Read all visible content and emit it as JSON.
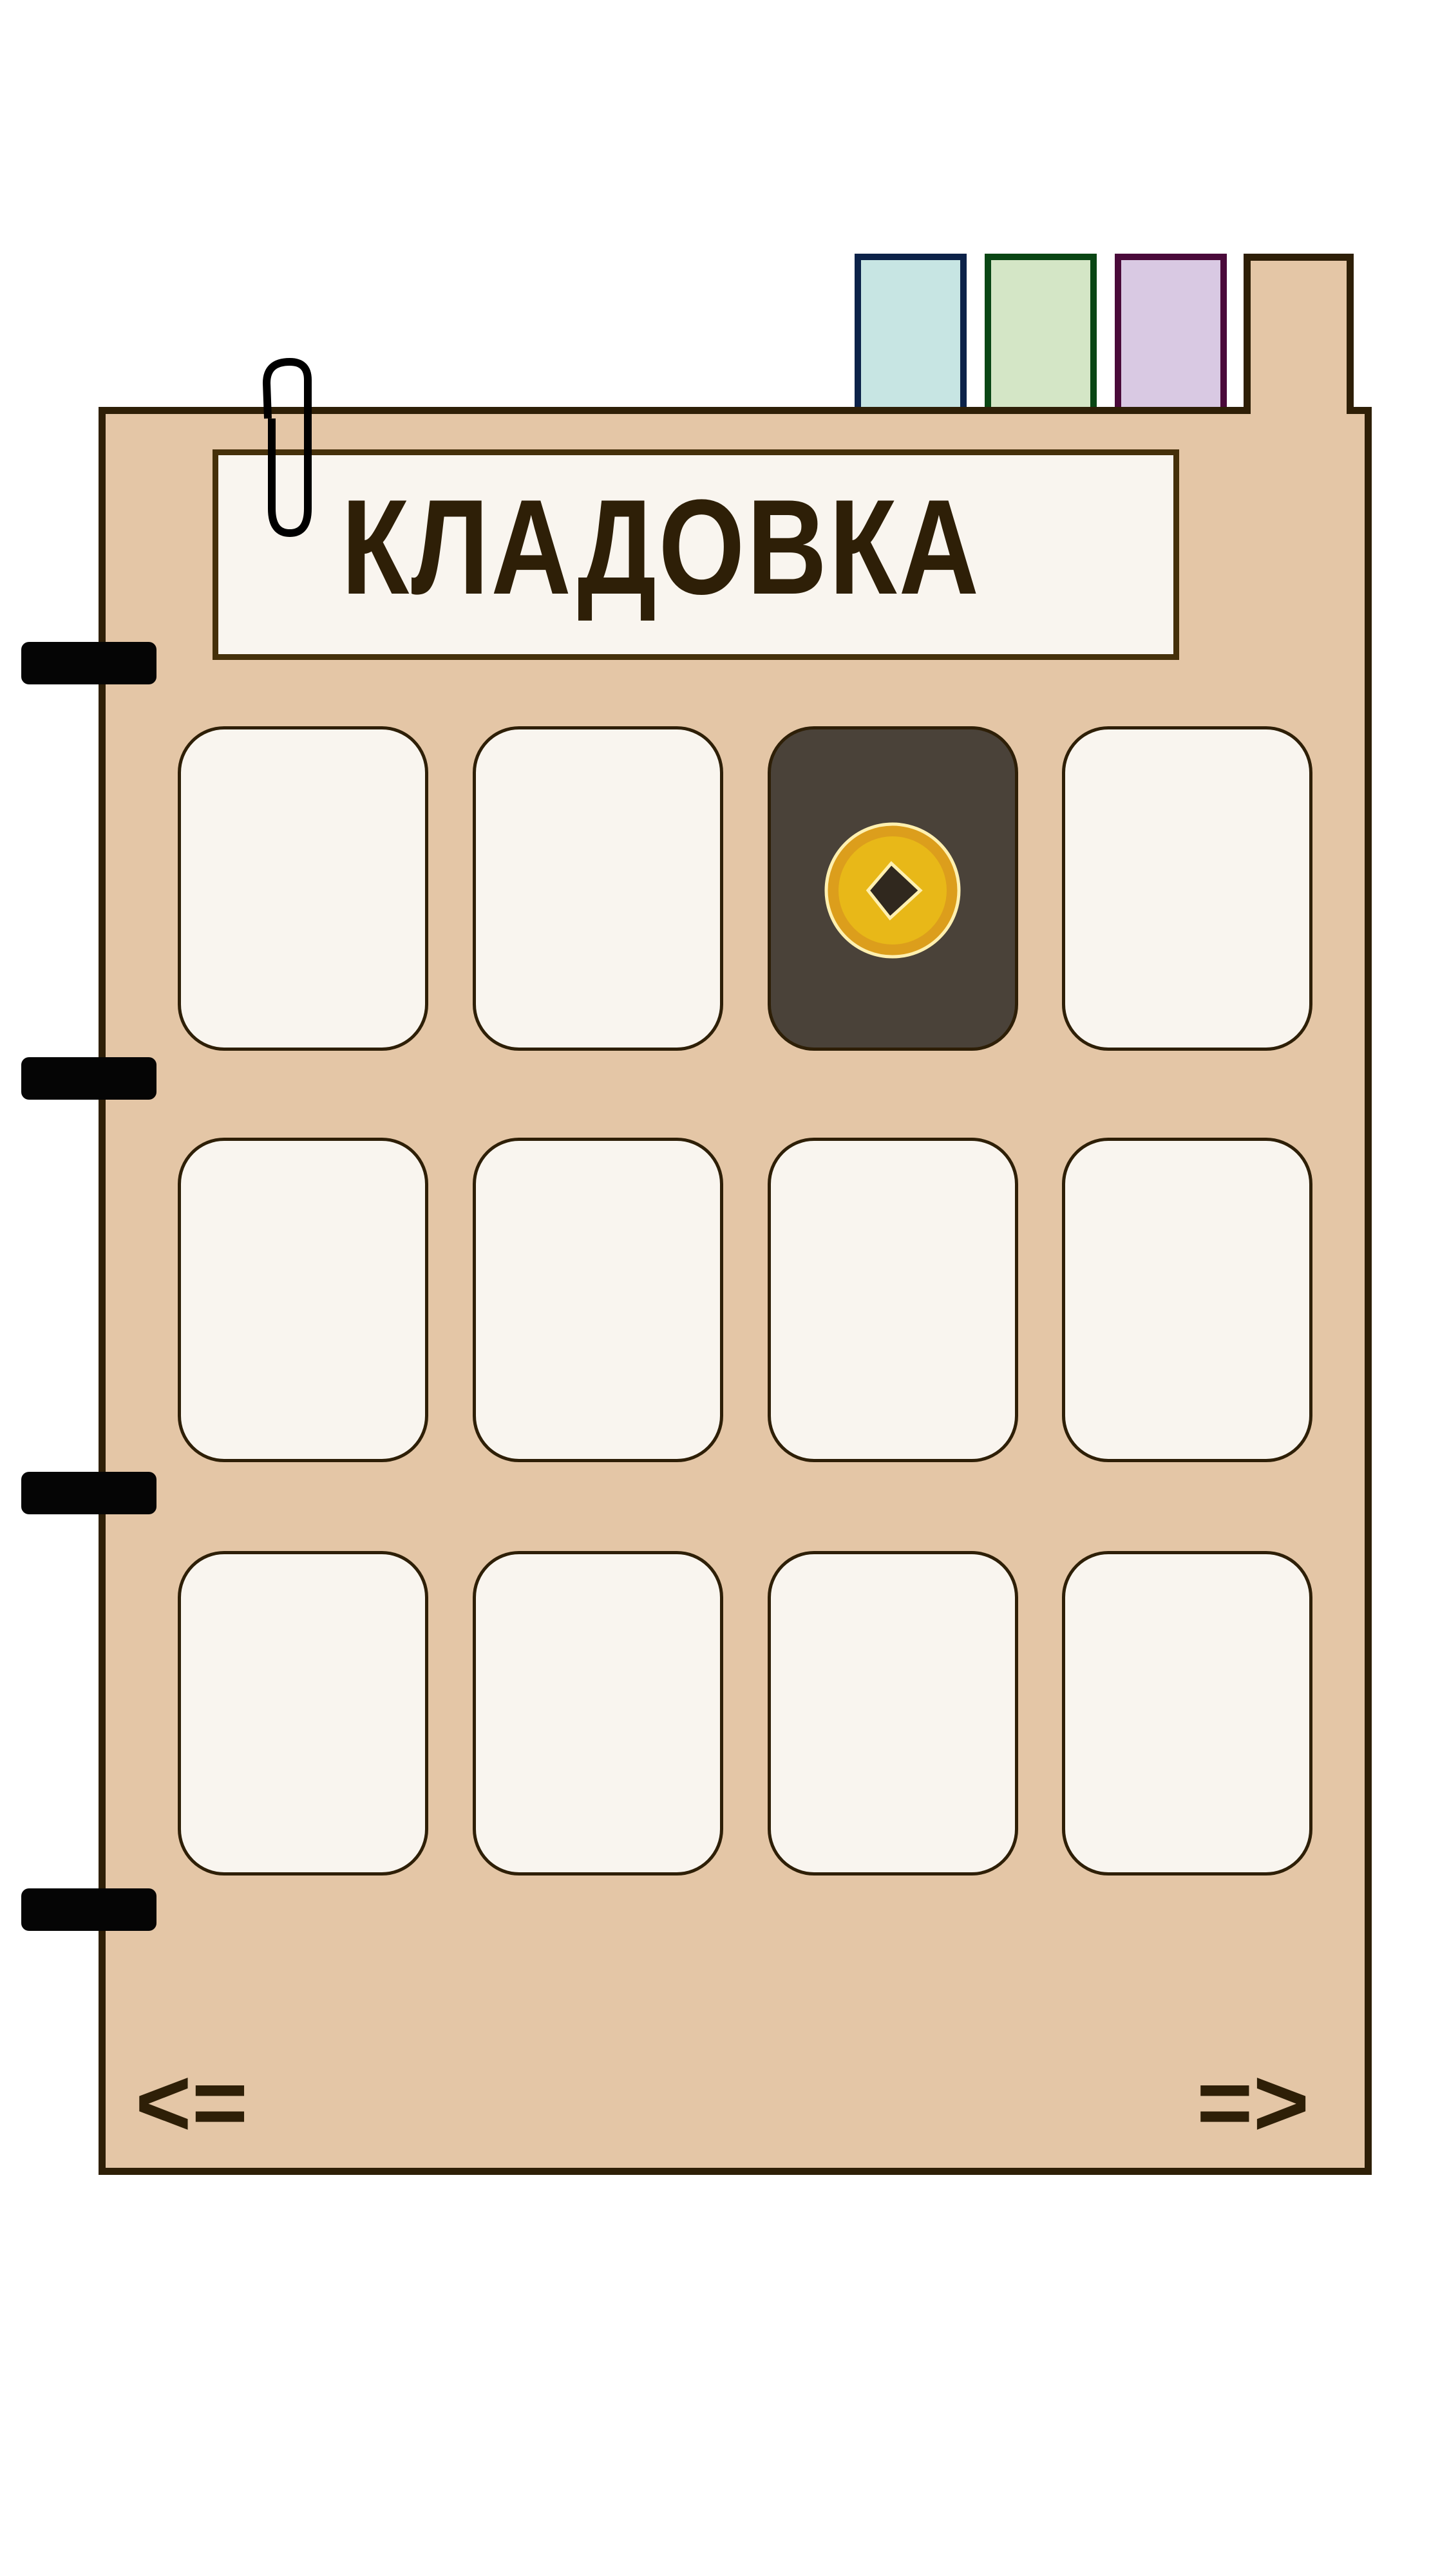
{
  "title": "КЛАДОВКА",
  "tabs": [
    {
      "name": "blue",
      "fill": "#c7e5e3",
      "border": "#0c2249"
    },
    {
      "name": "green",
      "fill": "#d4e6c6",
      "border": "#0a4614"
    },
    {
      "name": "purple",
      "fill": "#d9c9e3",
      "border": "#4a0a3a"
    }
  ],
  "slots": [
    {
      "item": null
    },
    {
      "item": null
    },
    {
      "item": "coin"
    },
    {
      "item": null
    },
    {
      "item": null
    },
    {
      "item": null
    },
    {
      "item": null
    },
    {
      "item": null
    },
    {
      "item": null
    },
    {
      "item": null
    },
    {
      "item": null
    },
    {
      "item": null
    }
  ],
  "nav": {
    "prev_label": "<=",
    "next_label": "=>"
  },
  "colors": {
    "page": "#e4c6a6",
    "outline": "#2e1f07",
    "slot": "#f9f5ef",
    "slot_selected": "#4a4239",
    "coin": "#e8b818"
  }
}
